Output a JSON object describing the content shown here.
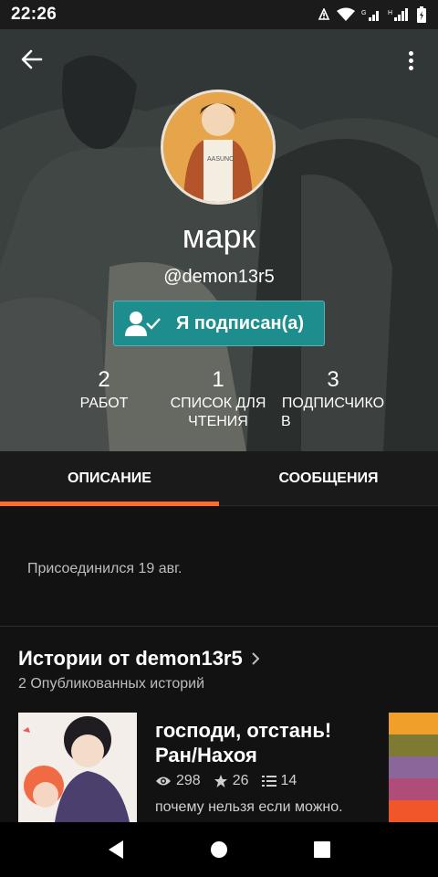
{
  "status_bar": {
    "time": "22:26",
    "icons": [
      "alarm-icon",
      "wifi-icon",
      "signal-icon",
      "signal-icon",
      "battery-icon"
    ]
  },
  "header": {
    "back_icon": "arrow-left-icon",
    "menu_icon": "more-vertical-icon",
    "display_name": "марк",
    "username": "@demon13r5",
    "follow_button": {
      "label": "Я подписан(а)",
      "icon": "person-check-icon",
      "color": "#1d8d8d"
    },
    "stats": [
      {
        "value": "2",
        "label_line1": "РАБОТ",
        "label_line2": ""
      },
      {
        "value": "1",
        "label_line1": "СПИСОК ДЛЯ",
        "label_line2": "ЧТЕНИЯ"
      },
      {
        "value": "3",
        "label_line1": "ПОДПИСЧИКО",
        "label_line2": "В"
      }
    ]
  },
  "tabs": [
    {
      "label": "ОПИСАНИЕ",
      "active": true
    },
    {
      "label": "СООБЩЕНИЯ",
      "active": false
    }
  ],
  "accent_color": "#ff6d2d",
  "about": {
    "joined": "Присоединился 19 авг."
  },
  "stories": {
    "title": "Истории от demon13r5",
    "subtitle": "2 Опубликованных историй",
    "items": [
      {
        "title": "господи, отстань! Ран/Нахоя",
        "reads": "298",
        "votes": "26",
        "parts": "14",
        "description": "почему нельзя если можно."
      }
    ]
  },
  "nav_bar": {
    "buttons": [
      "back-triangle-icon",
      "home-circle-icon",
      "recents-square-icon"
    ]
  }
}
